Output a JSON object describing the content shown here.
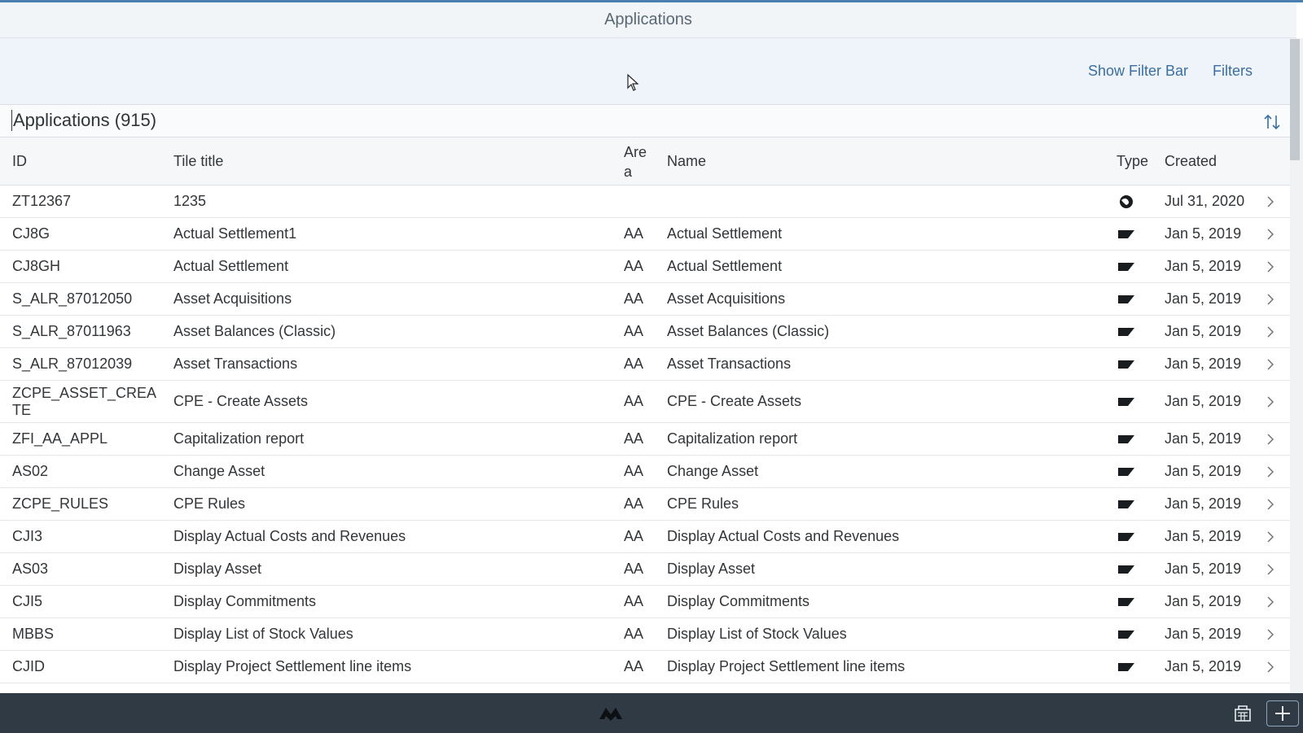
{
  "header": {
    "title": "Applications"
  },
  "filter_bar": {
    "show_filter_bar": "Show Filter Bar",
    "filters": "Filters"
  },
  "table": {
    "title": "Applications (915)",
    "columns": {
      "id": "ID",
      "tile_title": "Tile title",
      "area": "Area",
      "name": "Name",
      "type": "Type",
      "created": "Created"
    },
    "rows": [
      {
        "id": "ZT12367",
        "tile_title": "1235",
        "area": "",
        "name": "",
        "type_icon": "globe-icon",
        "created": "Jul 31, 2020"
      },
      {
        "id": "CJ8G",
        "tile_title": "Actual Settlement1",
        "area": "AA",
        "name": "Actual Settlement",
        "type_icon": "transaction-icon",
        "created": "Jan 5, 2019"
      },
      {
        "id": "CJ8GH",
        "tile_title": "Actual Settlement",
        "area": "AA",
        "name": "Actual Settlement",
        "type_icon": "transaction-icon",
        "created": "Jan 5, 2019"
      },
      {
        "id": "S_ALR_87012050",
        "tile_title": "Asset Acquisitions",
        "area": "AA",
        "name": "Asset Acquisitions",
        "type_icon": "transaction-icon",
        "created": "Jan 5, 2019"
      },
      {
        "id": "S_ALR_87011963",
        "tile_title": "Asset Balances (Classic)",
        "area": "AA",
        "name": "Asset Balances (Classic)",
        "type_icon": "transaction-icon",
        "created": "Jan 5, 2019"
      },
      {
        "id": "S_ALR_87012039",
        "tile_title": "Asset Transactions",
        "area": "AA",
        "name": "Asset Transactions",
        "type_icon": "transaction-icon",
        "created": "Jan 5, 2019"
      },
      {
        "id": "ZCPE_ASSET_CREATE",
        "tile_title": "CPE - Create Assets",
        "area": "AA",
        "name": "CPE - Create Assets",
        "type_icon": "transaction-icon",
        "created": "Jan 5, 2019"
      },
      {
        "id": "ZFI_AA_APPL",
        "tile_title": "Capitalization report",
        "area": "AA",
        "name": "Capitalization report",
        "type_icon": "transaction-icon",
        "created": "Jan 5, 2019"
      },
      {
        "id": "AS02",
        "tile_title": "Change Asset",
        "area": "AA",
        "name": "Change Asset",
        "type_icon": "transaction-icon",
        "created": "Jan 5, 2019"
      },
      {
        "id": "ZCPE_RULES",
        "tile_title": "CPE Rules",
        "area": "AA",
        "name": "CPE Rules",
        "type_icon": "transaction-icon",
        "created": "Jan 5, 2019"
      },
      {
        "id": "CJI3",
        "tile_title": "Display Actual Costs and Revenues",
        "area": "AA",
        "name": "Display Actual Costs and Revenues",
        "type_icon": "transaction-icon",
        "created": "Jan 5, 2019"
      },
      {
        "id": "AS03",
        "tile_title": "Display Asset",
        "area": "AA",
        "name": "Display Asset",
        "type_icon": "transaction-icon",
        "created": "Jan 5, 2019"
      },
      {
        "id": "CJI5",
        "tile_title": "Display Commitments",
        "area": "AA",
        "name": "Display Commitments",
        "type_icon": "transaction-icon",
        "created": "Jan 5, 2019"
      },
      {
        "id": "MBBS",
        "tile_title": "Display List of Stock Values",
        "area": "AA",
        "name": "Display List of Stock Values",
        "type_icon": "transaction-icon",
        "created": "Jan 5, 2019"
      },
      {
        "id": "CJID",
        "tile_title": "Display Project Settlement line items",
        "area": "AA",
        "name": "Display Project Settlement line items",
        "type_icon": "transaction-icon",
        "created": "Jan 5, 2019"
      }
    ]
  },
  "footer": {
    "logo_icon": "app-logo-icon",
    "action_a_icon": "export-icon",
    "action_b_icon": "add-icon"
  },
  "colors": {
    "accent": "#4a7eb0",
    "link": "#3a6ea0",
    "footer_bg": "#2f3a44",
    "header_bg": "#f2f5f8",
    "filter_bg": "#eef4fa"
  }
}
